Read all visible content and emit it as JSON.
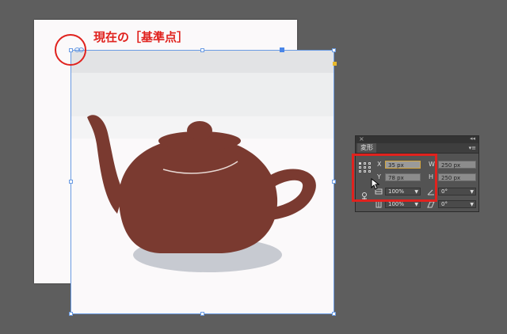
{
  "caption": "現在の［基準点］",
  "panel": {
    "title": "変形",
    "close_glyph": "×",
    "collapse_glyph": "◂◂",
    "menu_glyph": "▾≡",
    "x_label": "X",
    "x_value": "35 px",
    "y_label": "Y",
    "y_value": "78 px",
    "w_label": "W",
    "w_value": "250 px",
    "h_label": "H",
    "h_value": "250 px",
    "scale_x": "100%",
    "scale_y": "100%",
    "rotate": "0°",
    "shear": "0°",
    "dropdown_arrow": "▼"
  },
  "colors": {
    "annotation": "#e0221e",
    "teapot": "#7a3a30",
    "shadow": "#c7cad1",
    "selection": "#6a9be3"
  }
}
